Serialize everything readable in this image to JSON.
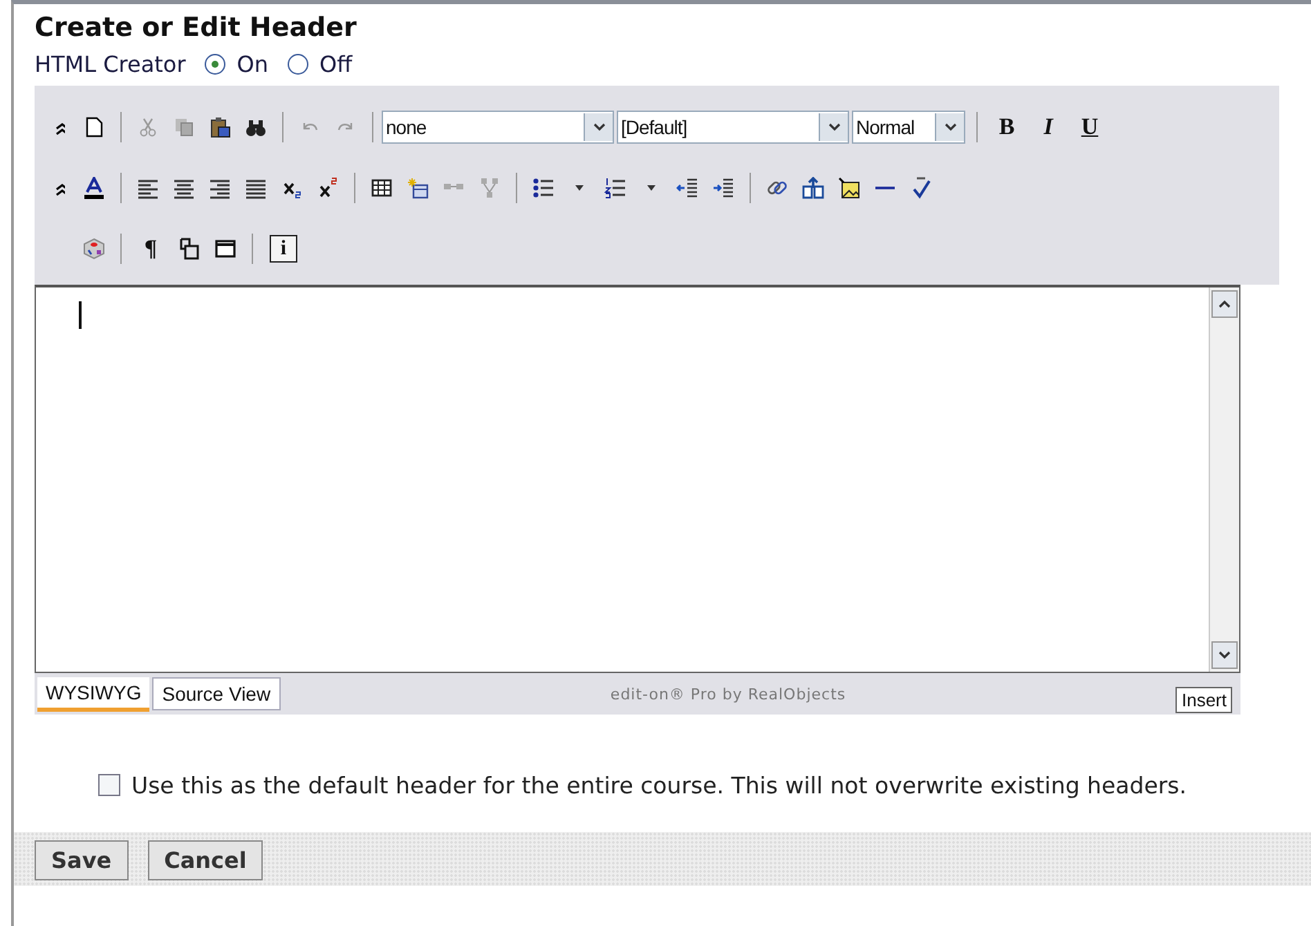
{
  "page": {
    "title": "Create or Edit Header"
  },
  "html_creator": {
    "label": "HTML Creator",
    "options": [
      {
        "label": "On",
        "selected": true
      },
      {
        "label": "Off",
        "selected": false
      }
    ]
  },
  "toolbar": {
    "style_select": {
      "value": "none"
    },
    "font_select": {
      "value": "[Default]"
    },
    "size_select": {
      "value": "Normal"
    },
    "bold": "B",
    "italic": "I",
    "underline": "U",
    "paragraph": "¶",
    "info": "i"
  },
  "editor": {
    "tabs": [
      {
        "label": "WYSIWYG",
        "selected": true
      },
      {
        "label": "Source View",
        "selected": false
      }
    ],
    "branding": "edit-on® Pro by RealObjects",
    "mode": "Insert"
  },
  "default_option": {
    "label": "Use this as the default header for the entire course. This will not overwrite existing headers.",
    "checked": false
  },
  "buttons": [
    {
      "label": "Save"
    },
    {
      "label": "Cancel"
    }
  ]
}
